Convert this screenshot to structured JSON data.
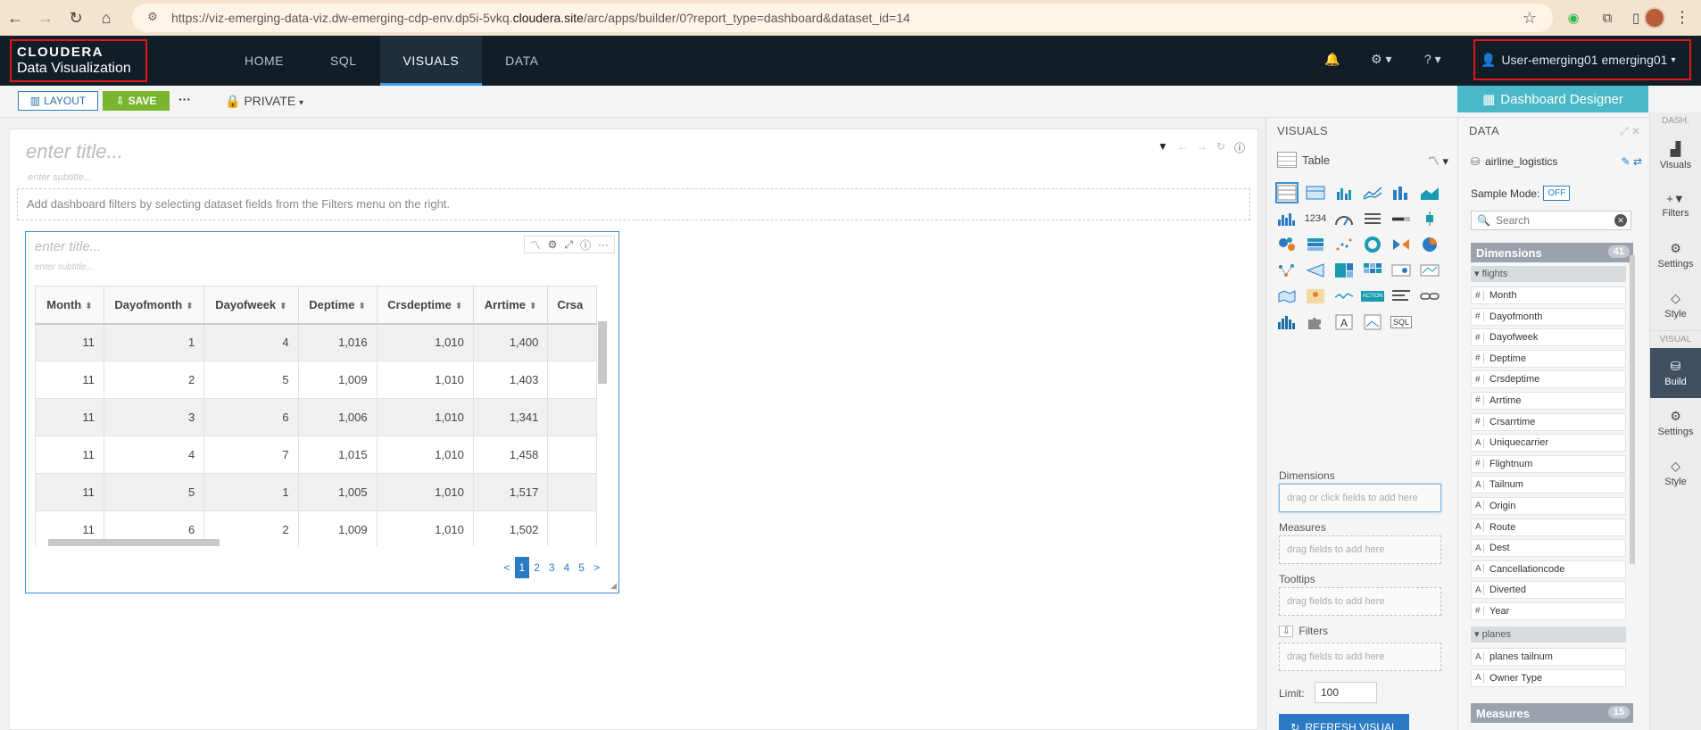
{
  "browser": {
    "url_prefix": "https://viz-emerging-data-viz.dw-emerging-cdp-env.dp5i-5vkq.",
    "url_domain": "cloudera.site",
    "url_path": "/arc/apps/builder/0?report_type=dashboard&dataset_id=14"
  },
  "header": {
    "brand": "CLOUDERA",
    "product": "Data Visualization",
    "tabs": [
      "HOME",
      "SQL",
      "VISUALS",
      "DATA"
    ],
    "active_tab": "VISUALS",
    "user": "User-emerging01 emerging01"
  },
  "toolbar": {
    "layout_label": "LAYOUT",
    "save_label": "SAVE",
    "more_label": "···",
    "private_label": "PRIVATE"
  },
  "designer_label": "Dashboard Designer",
  "dashboard": {
    "title_placeholder": "enter title...",
    "subtitle_placeholder": "enter subtitle...",
    "filter_hint": "Add dashboard filters by selecting dataset fields from the Filters menu on the right."
  },
  "visual": {
    "title_placeholder": "enter title...",
    "subtitle_placeholder": "enter subtitle...",
    "columns": [
      "Month",
      "Dayofmonth",
      "Dayofweek",
      "Deptime",
      "Crsdeptime",
      "Arrtime",
      "Crsa"
    ],
    "rows": [
      [
        "11",
        "1",
        "4",
        "1,016",
        "1,010",
        "1,400",
        ""
      ],
      [
        "11",
        "2",
        "5",
        "1,009",
        "1,010",
        "1,403",
        ""
      ],
      [
        "11",
        "3",
        "6",
        "1,006",
        "1,010",
        "1,341",
        ""
      ],
      [
        "11",
        "4",
        "7",
        "1,015",
        "1,010",
        "1,458",
        ""
      ],
      [
        "11",
        "5",
        "1",
        "1,005",
        "1,010",
        "1,517",
        ""
      ],
      [
        "11",
        "6",
        "2",
        "1,009",
        "1,010",
        "1,502",
        ""
      ]
    ],
    "pages": [
      "1",
      "2",
      "3",
      "4",
      "5"
    ],
    "current_page": "1",
    "prev": "<",
    "next": ">"
  },
  "visuals_panel": {
    "heading": "VISUALS",
    "selected_type": "Table",
    "dimensions_label": "Dimensions",
    "dimensions_hint": "drag or click fields to add here",
    "measures_label": "Measures",
    "measures_hint": "drag fields to add here",
    "tooltips_label": "Tooltips",
    "tooltips_hint": "drag fields to add here",
    "filters_label": "Filters",
    "filters_hint": "drag fields to add here",
    "limit_label": "Limit:",
    "limit_value": "100",
    "refresh_label": "REFRESH VISUAL",
    "icon_kpi_text": "1234",
    "icon_action_text": "ACTION",
    "icon_sql_text": "SQL"
  },
  "data_panel": {
    "heading": "DATA",
    "dataset": "airline_logistics",
    "sample_label": "Sample Mode:",
    "sample_value": "OFF",
    "search_placeholder": "Search",
    "dimensions_label": "Dimensions",
    "dimensions_count": "41",
    "group1": "flights",
    "fields1": [
      {
        "type": "#",
        "name": "Month"
      },
      {
        "type": "#",
        "name": "Dayofmonth"
      },
      {
        "type": "#",
        "name": "Dayofweek"
      },
      {
        "type": "#",
        "name": "Deptime"
      },
      {
        "type": "#",
        "name": "Crsdeptime"
      },
      {
        "type": "#",
        "name": "Arrtime"
      },
      {
        "type": "#",
        "name": "Crsarrtime"
      },
      {
        "type": "A",
        "name": "Uniquecarrier"
      },
      {
        "type": "#",
        "name": "Flightnum"
      },
      {
        "type": "A",
        "name": "Tailnum"
      },
      {
        "type": "A",
        "name": "Origin"
      },
      {
        "type": "A",
        "name": "Route"
      },
      {
        "type": "A",
        "name": "Dest"
      },
      {
        "type": "A",
        "name": "Cancellationcode"
      },
      {
        "type": "A",
        "name": "Diverted"
      },
      {
        "type": "#",
        "name": "Year"
      }
    ],
    "group2": "planes",
    "fields2": [
      {
        "type": "A",
        "name": "planes tailnum"
      },
      {
        "type": "A",
        "name": "Owner Type"
      }
    ],
    "measures_label": "Measures",
    "measures_count": "15"
  },
  "rail": {
    "dash_header": "DASH.",
    "dash_items": [
      "Visuals",
      "Filters",
      "Settings",
      "Style"
    ],
    "visual_header": "VISUAL",
    "visual_items": [
      "Build",
      "Settings",
      "Style"
    ],
    "active_item": "Build"
  },
  "colors": {
    "header_bg": "#111d27",
    "accent_blue": "#2a7bc4",
    "save_green": "#79b52e",
    "designer_teal": "#4ab8c6",
    "highlight_red": "#e1161c"
  }
}
